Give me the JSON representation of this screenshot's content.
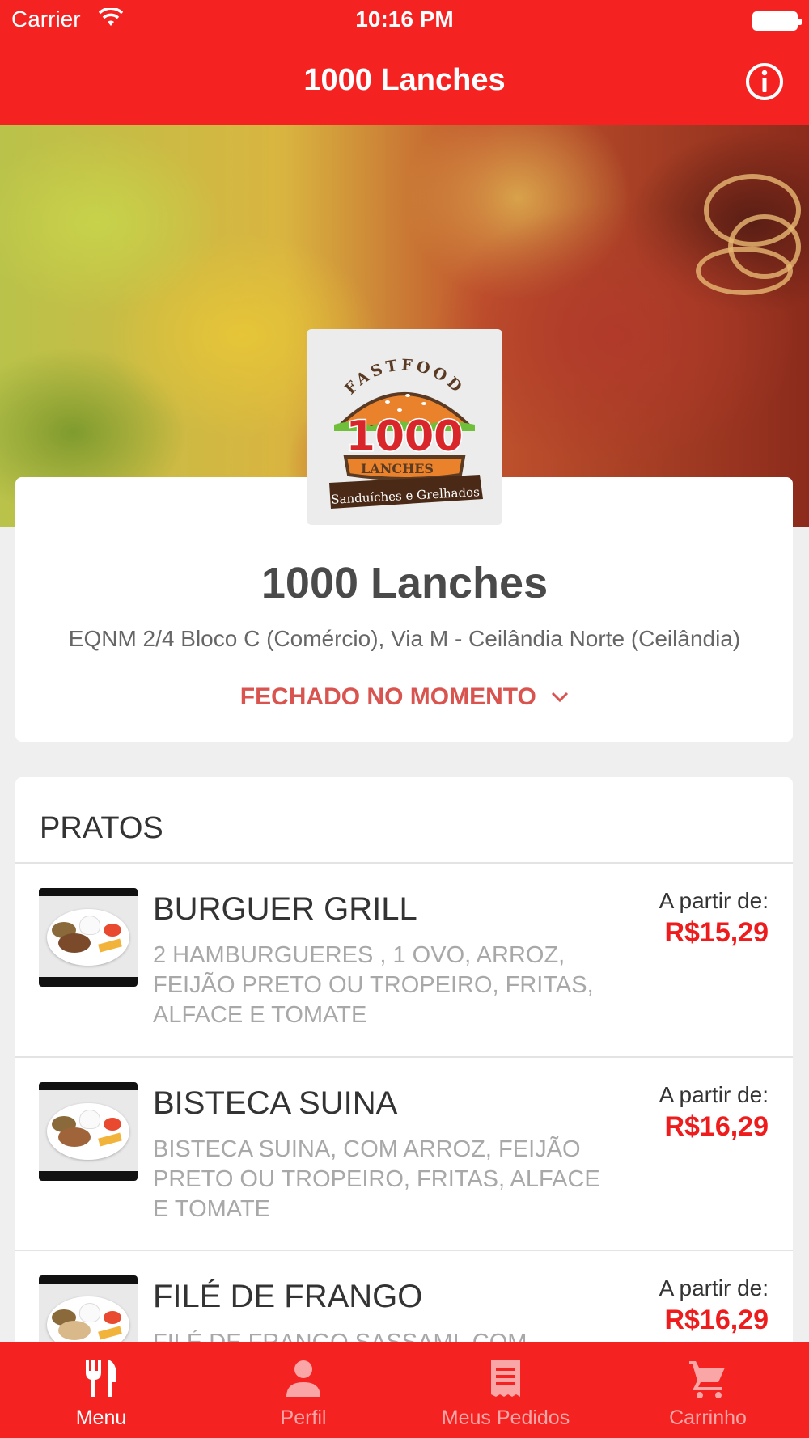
{
  "status_bar": {
    "carrier": "Carrier",
    "time": "10:16 PM"
  },
  "nav": {
    "title": "1000 Lanches",
    "info_icon": "info-circle-icon"
  },
  "restaurant": {
    "logo": {
      "top_text": "FASTFOOD",
      "number": "1000",
      "banner": "LANCHES",
      "tagline": "Sanduíches e Grelhados"
    },
    "name": "1000 Lanches",
    "address": "EQNM 2/4 Bloco C (Comércio), Via M - Ceilândia Norte (Ceilândia)",
    "status": "FECHADO NO MOMENTO"
  },
  "menu": {
    "section_title": "PRATOS",
    "items": [
      {
        "name": "BURGUER GRILL",
        "description": "2 HAMBURGUERES , 1 OVO, ARROZ, FEIJÃO PRETO OU TROPEIRO, FRITAS, ALFACE E TOMATE",
        "from_label": "A partir de:",
        "price": "R$15,29"
      },
      {
        "name": "BISTECA SUINA",
        "description": "BISTECA SUINA, COM ARROZ, FEIJÃO PRETO OU TROPEIRO, FRITAS, ALFACE E TOMATE",
        "from_label": "A partir de:",
        "price": "R$16,29"
      },
      {
        "name": "FILÉ DE FRANGO",
        "description": "FILÉ DE FRANGO SASSAMI, COM",
        "from_label": "A partir de:",
        "price": "R$16,29"
      }
    ]
  },
  "tabbar": {
    "tabs": [
      {
        "label": "Menu",
        "icon": "fork-knife-icon",
        "active": true
      },
      {
        "label": "Perfil",
        "icon": "person-icon",
        "active": false
      },
      {
        "label": "Meus Pedidos",
        "icon": "receipt-icon",
        "active": false
      },
      {
        "label": "Carrinho",
        "icon": "cart-icon",
        "active": false
      }
    ]
  },
  "colors": {
    "brand_red": "#f52222",
    "price_red": "#ee1c1c",
    "status_red": "#d9534f"
  }
}
